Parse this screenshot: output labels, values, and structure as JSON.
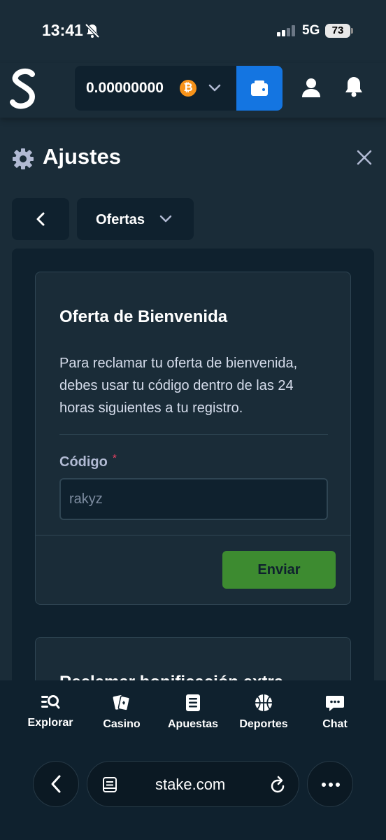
{
  "status_bar": {
    "time": "13:41",
    "network": "5G",
    "battery": "73"
  },
  "header": {
    "balance": "0.00000000",
    "currency_symbol": "₿"
  },
  "settings": {
    "title": "Ajustes",
    "section": "Ofertas"
  },
  "welcome_offer": {
    "title": "Oferta de Bienvenida",
    "description": "Para reclamar tu oferta de bienvenida, debes usar tu código dentro de las 24 horas siguientes a tu registro.",
    "code_label": "Código",
    "required_mark": "*",
    "code_value": "rakyz",
    "submit_label": "Enviar"
  },
  "extra_bonus": {
    "title": "Reclamar bonificación extra"
  },
  "bottom_nav": {
    "items": [
      {
        "label": "Explorar",
        "icon": "explore-icon"
      },
      {
        "label": "Casino",
        "icon": "cards-icon"
      },
      {
        "label": "Apuestas",
        "icon": "betslip-icon"
      },
      {
        "label": "Deportes",
        "icon": "basketball-icon"
      },
      {
        "label": "Chat",
        "icon": "chat-icon"
      }
    ]
  },
  "browser": {
    "url": "stake.com"
  },
  "colors": {
    "background": "#1a2c38",
    "panel": "#0f212e",
    "accent_blue": "#1475e1",
    "submit_green": "#3d8b30",
    "bitcoin": "#f7931a"
  }
}
